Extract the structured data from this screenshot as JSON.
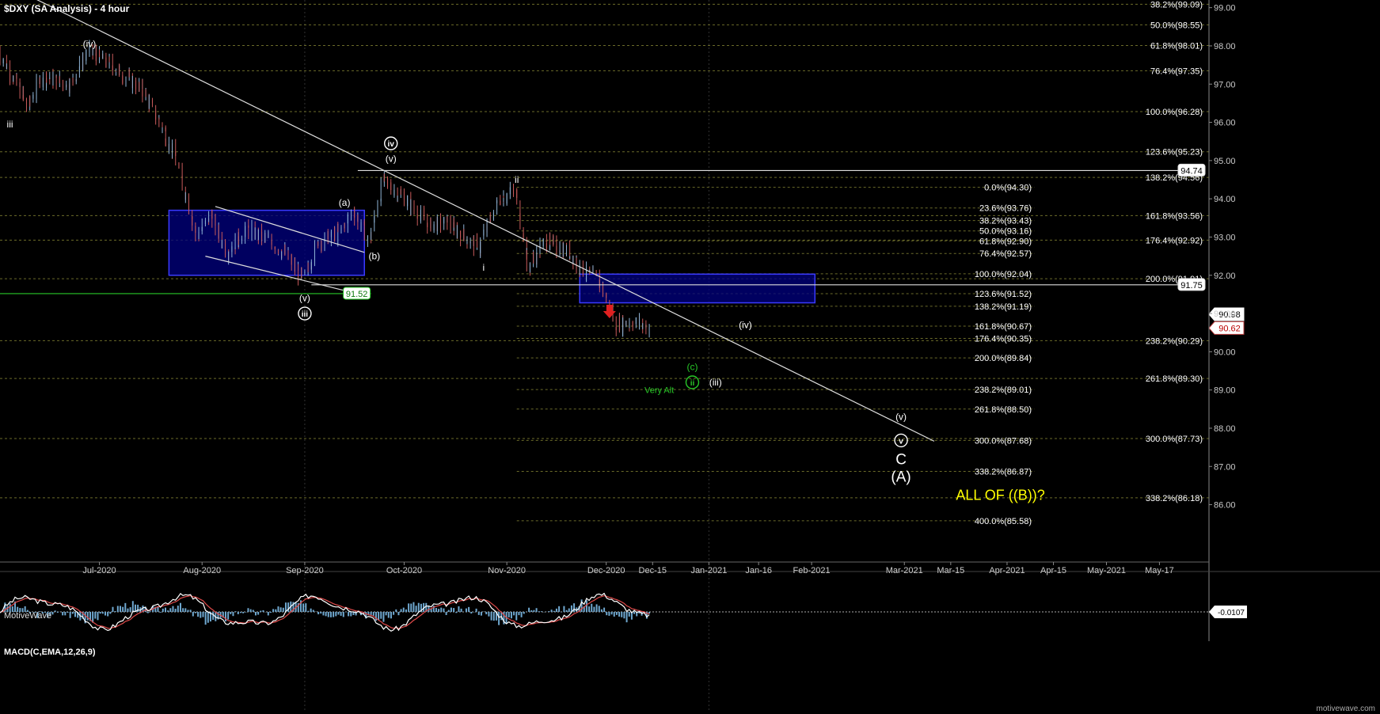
{
  "page": {
    "title": "$DXY (SA Analysis) - 4 hour",
    "watermark": "MotiveWave",
    "footer": "motivewave.com"
  },
  "colors": {
    "background": "#000000",
    "grid": "#333333",
    "fib_line": "#6b6b2a",
    "up_candle": "#8fb4d6",
    "down_candle": "#c85a5a",
    "box_fill": "#000080",
    "box_stroke": "#3a3aff",
    "white": "#ffffff",
    "green": "#28c828",
    "yellow": "#ffff00",
    "red": "#e02020",
    "histogram": "#6fa8d0",
    "macd_line": "#ffffff",
    "signal_line": "#e04a4a"
  },
  "chart_data": {
    "type": "candlestick",
    "title": "$DXY (SA Analysis) - 4 hour",
    "xlim": [
      "2020-06-01",
      "2021-05-31"
    ],
    "ylim": [
      84.5,
      99.2
    ],
    "x_ticks": [
      "Jul-2020",
      "Aug-2020",
      "Sep-2020",
      "Oct-2020",
      "Nov-2020",
      "Dec-2020",
      "Dec-15",
      "Jan-2021",
      "Jan-16",
      "Feb-2021",
      "Mar-2021",
      "Mar-15",
      "Apr-2021",
      "Apr-15",
      "May-2021",
      "May-17"
    ],
    "y_ticks": [
      "86.00",
      "87.00",
      "88.00",
      "89.00",
      "90.00",
      "91.00",
      "92.00",
      "93.00",
      "94.00",
      "95.00",
      "96.00",
      "97.00",
      "98.00",
      "99.00"
    ],
    "price_path": [
      [
        "2020-06-01",
        97.9
      ],
      [
        "2020-06-10",
        96.4
      ],
      [
        "2020-06-14",
        97.2
      ],
      [
        "2020-06-23",
        97.0
      ],
      [
        "2020-06-28",
        97.9
      ],
      [
        "2020-07-05",
        97.5
      ],
      [
        "2020-07-15",
        96.8
      ],
      [
        "2020-07-24",
        95.2
      ],
      [
        "2020-07-31",
        93.0
      ],
      [
        "2020-08-04",
        93.6
      ],
      [
        "2020-08-09",
        92.6
      ],
      [
        "2020-08-15",
        93.2
      ],
      [
        "2020-08-22",
        92.9
      ],
      [
        "2020-08-27",
        92.5
      ],
      [
        "2020-09-01",
        91.9
      ],
      [
        "2020-09-06",
        92.9
      ],
      [
        "2020-09-12",
        93.1
      ],
      [
        "2020-09-16",
        93.7
      ],
      [
        "2020-09-21",
        92.9
      ],
      [
        "2020-09-25",
        94.5
      ],
      [
        "2020-09-29",
        94.2
      ],
      [
        "2020-10-04",
        93.8
      ],
      [
        "2020-10-09",
        93.3
      ],
      [
        "2020-10-14",
        93.4
      ],
      [
        "2020-10-20",
        93.0
      ],
      [
        "2020-10-24",
        92.7
      ],
      [
        "2020-10-30",
        94.0
      ],
      [
        "2020-11-04",
        94.2
      ],
      [
        "2020-11-08",
        92.2
      ],
      [
        "2020-11-13",
        92.9
      ],
      [
        "2020-11-20",
        92.6
      ],
      [
        "2020-11-25",
        92.1
      ],
      [
        "2020-11-30",
        91.8
      ],
      [
        "2020-12-04",
        90.7
      ],
      [
        "2020-12-10",
        90.8
      ],
      [
        "2020-12-14",
        90.62
      ]
    ],
    "candle_count": 420,
    "fib_levels_right": [
      {
        "label": "38.2%(99.09)",
        "value": 99.09
      },
      {
        "label": "50.0%(98.55)",
        "value": 98.55
      },
      {
        "label": "61.8%(98.01)",
        "value": 98.01
      },
      {
        "label": "76.4%(97.35)",
        "value": 97.35
      },
      {
        "label": "100.0%(96.28)",
        "value": 96.28
      },
      {
        "label": "123.6%(95.23)",
        "value": 95.23
      },
      {
        "label": "138.2%(94.56)",
        "value": 94.56
      },
      {
        "label": "161.8%(93.56)",
        "value": 93.56
      },
      {
        "label": "176.4%(92.92)",
        "value": 92.92
      },
      {
        "label": "200.0%(91.91)",
        "value": 91.91
      },
      {
        "label": "238.2%(90.29)",
        "value": 90.29
      },
      {
        "label": "261.8%(89.30)",
        "value": 89.3
      },
      {
        "label": "300.0%(87.73)",
        "value": 87.73
      },
      {
        "label": "338.2%(86.18)",
        "value": 86.18
      }
    ],
    "fib_levels_mid": [
      {
        "label": "0.0%(94.30)",
        "value": 94.3
      },
      {
        "label": "23.6%(93.76)",
        "value": 93.76
      },
      {
        "label": "38.2%(93.43)",
        "value": 93.43
      },
      {
        "label": "50.0%(93.16)",
        "value": 93.16
      },
      {
        "label": "61.8%(92.90)",
        "value": 92.9
      },
      {
        "label": "76.4%(92.57)",
        "value": 92.57
      },
      {
        "label": "100.0%(92.04)",
        "value": 92.04
      },
      {
        "label": "123.6%(91.52)",
        "value": 91.52
      },
      {
        "label": "138.2%(91.19)",
        "value": 91.19
      },
      {
        "label": "161.8%(90.67)",
        "value": 90.67
      },
      {
        "label": "176.4%(90.35)",
        "value": 90.35
      },
      {
        "label": "200.0%(89.84)",
        "value": 89.84
      },
      {
        "label": "238.2%(89.01)",
        "value": 89.01
      },
      {
        "label": "261.8%(88.50)",
        "value": 88.5
      },
      {
        "label": "300.0%(87.68)",
        "value": 87.68
      },
      {
        "label": "338.2%(86.87)",
        "value": 86.87
      },
      {
        "label": "400.0%(85.58)",
        "value": 85.58
      }
    ],
    "hlines": [
      {
        "value": 94.74,
        "from": "2020-09-17",
        "label": "94.74",
        "color": "white"
      },
      {
        "value": 91.75,
        "from": "2020-09-03",
        "label": "91.75",
        "color": "white"
      },
      {
        "value": 91.52,
        "from": "2020-06-01",
        "label": "91.52",
        "color": "green"
      }
    ],
    "trendline": [
      [
        "2020-06-10",
        99.3
      ],
      [
        "2021-03-10",
        87.66
      ]
    ],
    "channel": [
      [
        "2020-08-05",
        93.8
      ],
      [
        "2020-09-19",
        92.6
      ],
      [
        "2020-08-02",
        92.5
      ],
      [
        "2020-09-13",
        91.6
      ]
    ],
    "boxes": [
      {
        "from": "2020-07-22",
        "to": "2020-09-19",
        "top": 93.7,
        "bottom": 92.0
      },
      {
        "from": "2020-11-23",
        "to": "2021-02-02",
        "top": 92.03,
        "bottom": 91.28
      }
    ],
    "price_tags": [
      {
        "label": "90.98",
        "value": 90.98,
        "style": "white"
      },
      {
        "label": "90.62",
        "value": 90.62,
        "style": "red"
      }
    ],
    "wave_labels": [
      {
        "text": "(iv)",
        "date": "2020-06-28",
        "value": 98.05,
        "style": "small"
      },
      {
        "text": "iii",
        "date": "2020-06-04",
        "value": 95.95,
        "style": "small"
      },
      {
        "text": "iv",
        "date": "2020-09-27",
        "value": 95.45,
        "style": "circle"
      },
      {
        "text": "(v)",
        "date": "2020-09-27",
        "value": 95.05,
        "style": "small"
      },
      {
        "text": "ii",
        "date": "2020-11-04",
        "value": 94.5,
        "style": "small"
      },
      {
        "text": "(a)",
        "date": "2020-09-13",
        "value": 93.9,
        "style": "small"
      },
      {
        "text": "(b)",
        "date": "2020-09-22",
        "value": 92.5,
        "style": "small"
      },
      {
        "text": "i",
        "date": "2020-10-25",
        "value": 92.2,
        "style": "small"
      },
      {
        "text": "(v)",
        "date": "2020-09-01",
        "value": 91.4,
        "style": "small"
      },
      {
        "text": "iii",
        "date": "2020-09-01",
        "value": 91.0,
        "style": "circle"
      },
      {
        "text": "(iv)",
        "date": "2021-01-12",
        "value": 90.7,
        "style": "small"
      },
      {
        "text": "(c)",
        "date": "2020-12-27",
        "value": 89.6,
        "style": "green-small"
      },
      {
        "text": "ii",
        "date": "2020-12-27",
        "value": 89.2,
        "style": "green-circle"
      },
      {
        "text": "(iii)",
        "date": "2021-01-03",
        "value": 89.2,
        "style": "small"
      },
      {
        "text": "Very Alt",
        "date": "2020-12-17",
        "value": 89.0,
        "style": "green-text"
      },
      {
        "text": "(v)",
        "date": "2021-02-28",
        "value": 88.3,
        "style": "small"
      },
      {
        "text": "v",
        "date": "2021-02-28",
        "value": 87.68,
        "style": "circle"
      },
      {
        "text": "C",
        "date": "2021-02-28",
        "value": 87.2,
        "style": "large"
      },
      {
        "text": "(A)",
        "date": "2021-02-28",
        "value": 86.75,
        "style": "large"
      },
      {
        "text": "ALL OF ((B))?",
        "date": "2021-03-30",
        "value": 86.25,
        "style": "yellow"
      }
    ],
    "red_arrow": {
      "date": "2020-12-02",
      "value": 91.0
    },
    "macd": {
      "title": "MACD(C,EMA,12,26,9)",
      "current_value": "-0.0107",
      "ylim": [
        -0.9,
        0.9
      ],
      "zero": 0
    }
  }
}
